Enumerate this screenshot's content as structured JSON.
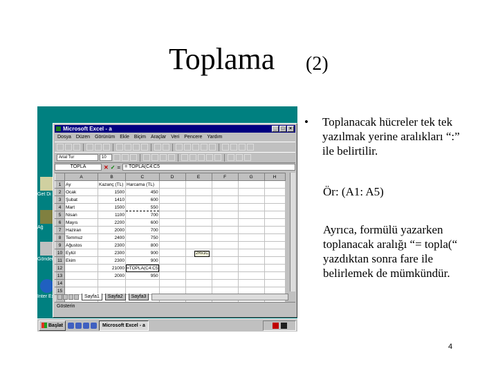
{
  "slide": {
    "title": "Toplama",
    "title_num": "(2)",
    "bullet": "•",
    "bullet_text": "Toplanacak hücreler tek tek yazılmak yerine aralıkları “:” ile belirtilir.",
    "example": "Ör: (A1: A5)",
    "paragraph": "Ayrıca, formülü yazarken toplanacak aralığı “= topla(“ yazdıktan sonra fare ile belirlemek de mümkündür.",
    "page_number": "4"
  },
  "screenshot": {
    "desktop_icons": [
      {
        "name": "desktop-icon-mycomputer",
        "label": "Get Di"
      },
      {
        "name": "desktop-icon-network",
        "label": "Ağ"
      },
      {
        "name": "desktop-icon-recycle",
        "label": "Gönder"
      },
      {
        "name": "desktop-icon-ie",
        "label": "Inter Explo"
      }
    ],
    "window": {
      "title": "Microsoft Excel - a",
      "menu": [
        "Dosya",
        "Düzen",
        "Görünüm",
        "Ekle",
        "Biçim",
        "Araçlar",
        "Veri",
        "Pencere",
        "Yardım"
      ],
      "font_name": "Arial Tur",
      "font_size": "10",
      "name_box": "TOPLA",
      "formula": "= TOPLA(C4:C5",
      "columns": [
        "",
        "A",
        "B",
        "C",
        "D",
        "E",
        "F",
        "G",
        "H"
      ],
      "rows": [
        {
          "n": "1",
          "a": "Ay",
          "b": "Kazanç (TL)",
          "c": "Harcama (TL)"
        },
        {
          "n": "2",
          "a": "Ocak",
          "b": "1500",
          "c": "450"
        },
        {
          "n": "3",
          "a": "Şubat",
          "b": "1410",
          "c": "600"
        },
        {
          "n": "4",
          "a": "Mart",
          "b": "1500",
          "c": "550"
        },
        {
          "n": "5",
          "a": "Nisan",
          "b": "1100",
          "c": "700"
        },
        {
          "n": "6",
          "a": "Mayıs",
          "b": "2200",
          "c": "600"
        },
        {
          "n": "7",
          "a": "Haziran",
          "b": "2000",
          "c": "700"
        },
        {
          "n": "8",
          "a": "Temmuz",
          "b": "2400",
          "c": "750"
        },
        {
          "n": "9",
          "a": "Ağustos",
          "b": "2300",
          "c": "800"
        },
        {
          "n": "10",
          "a": "Eylül",
          "b": "2300",
          "c": "900"
        },
        {
          "n": "11",
          "a": "Ekim",
          "b": "2300",
          "c": "900"
        },
        {
          "n": "12",
          "a": "",
          "b": "21000",
          "c": "=TOPLA(C4:C5"
        },
        {
          "n": "13",
          "a": "",
          "b": "2000",
          "c": "950"
        },
        {
          "n": "14",
          "a": "",
          "b": "",
          "c": ""
        },
        {
          "n": "15",
          "a": "",
          "b": "",
          "c": ""
        },
        {
          "n": "16",
          "a": "",
          "b": "",
          "c": ""
        }
      ],
      "tooltip": "2Rx1C",
      "sheet_tabs": [
        "Sayfa1",
        "Sayfa2",
        "Sayfa3"
      ],
      "status": "Gösterin"
    },
    "taskbar": {
      "start": "Başlat",
      "task": "Microsoft Excel - a"
    }
  }
}
